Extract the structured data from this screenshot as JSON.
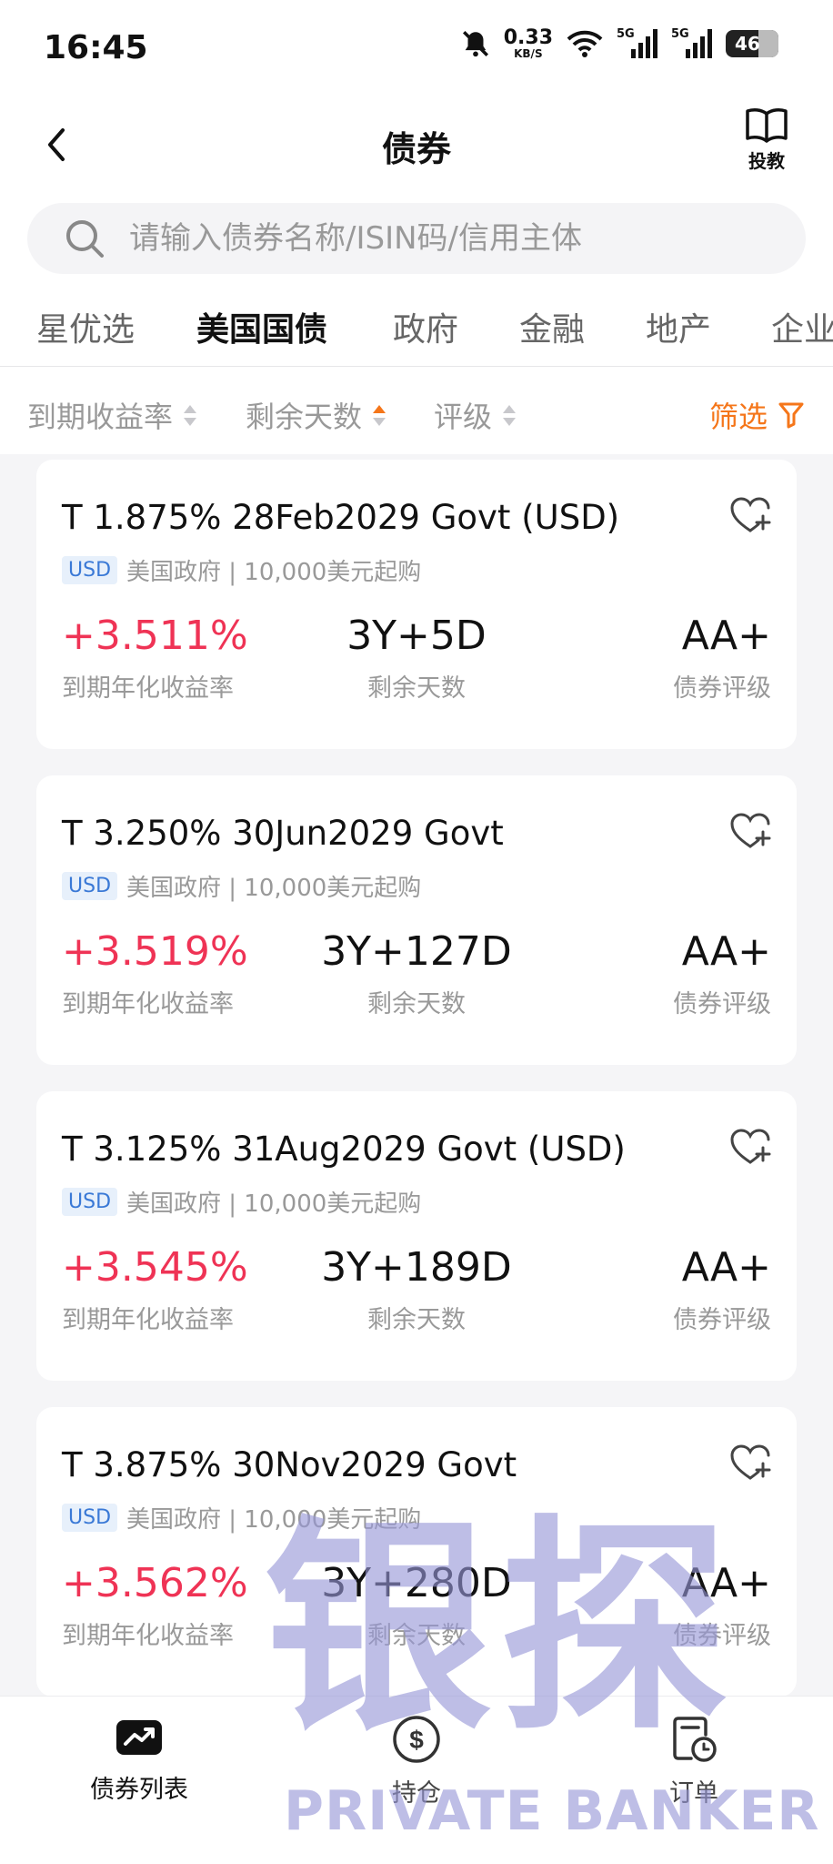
{
  "status_bar": {
    "time": "16:45",
    "net_speed_value": "0.33",
    "net_speed_unit": "KB/S",
    "signal1_label": "5G",
    "signal2_label": "5G",
    "battery": "46"
  },
  "nav": {
    "title": "债券",
    "tutorial_label": "投教"
  },
  "search": {
    "placeholder": "请输入债券名称/ISIN码/信用主体"
  },
  "tabs": [
    {
      "label": "星优选",
      "active": false
    },
    {
      "label": "美国国债",
      "active": true
    },
    {
      "label": "政府",
      "active": false
    },
    {
      "label": "金融",
      "active": false
    },
    {
      "label": "地产",
      "active": false
    },
    {
      "label": "企业",
      "active": false
    }
  ],
  "sort_bar": {
    "yield_label": "到期收益率",
    "days_label": "剩余天数",
    "rating_label": "评级",
    "filter_label": "筛选"
  },
  "bonds": [
    {
      "title": "T 1.875% 28Feb2029 Govt (USD)",
      "currency": "USD",
      "issuer_info": "美国政府 | 10,000美元起购",
      "yield": "+3.511%",
      "yield_label": "到期年化收益率",
      "remaining": "3Y+5D",
      "remaining_label": "剩余天数",
      "rating": "AA+",
      "rating_label": "债券评级"
    },
    {
      "title": "T 3.250% 30Jun2029 Govt",
      "currency": "USD",
      "issuer_info": "美国政府 | 10,000美元起购",
      "yield": "+3.519%",
      "yield_label": "到期年化收益率",
      "remaining": "3Y+127D",
      "remaining_label": "剩余天数",
      "rating": "AA+",
      "rating_label": "债券评级"
    },
    {
      "title": "T 3.125% 31Aug2029 Govt (USD)",
      "currency": "USD",
      "issuer_info": "美国政府 | 10,000美元起购",
      "yield": "+3.545%",
      "yield_label": "到期年化收益率",
      "remaining": "3Y+189D",
      "remaining_label": "剩余天数",
      "rating": "AA+",
      "rating_label": "债券评级"
    },
    {
      "title": "T 3.875% 30Nov2029 Govt",
      "currency": "USD",
      "issuer_info": "美国政府 | 10,000美元起购",
      "yield": "+3.562%",
      "yield_label": "到期年化收益率",
      "remaining": "3Y+280D",
      "remaining_label": "剩余天数",
      "rating": "AA+",
      "rating_label": "债券评级"
    }
  ],
  "bottom_nav": [
    {
      "label": "债券列表",
      "icon": "chart-card-icon",
      "active": true
    },
    {
      "label": "持仓",
      "icon": "dollar-coin-icon",
      "active": false
    },
    {
      "label": "订单",
      "icon": "order-clock-icon",
      "active": false
    }
  ],
  "watermark": {
    "chars": "银探",
    "text": "PRIVATE BANKER"
  },
  "colors": {
    "accent": "#f5761a",
    "yield_red": "#ef3355",
    "badge_blue": "#3a79d6"
  }
}
